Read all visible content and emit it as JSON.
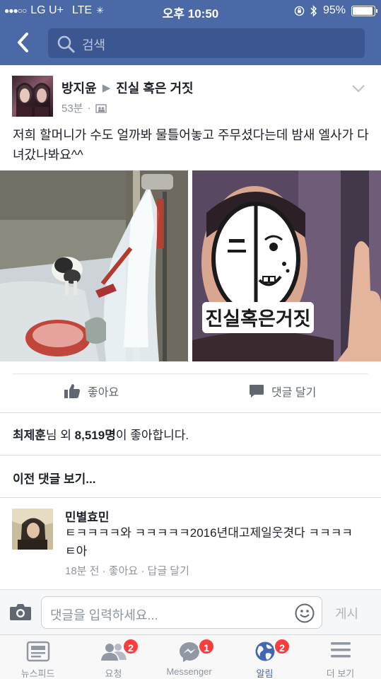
{
  "status_bar": {
    "carrier": "LG U+",
    "network": "LTE",
    "time": "오후 10:50",
    "battery_percent": "95%",
    "battery_level": 0.95
  },
  "nav": {
    "search_placeholder": "검색"
  },
  "post": {
    "author": "방지윤",
    "group": "진실 혹은 거짓",
    "time": "53분",
    "meta_sep": "·",
    "text": "저희 할머니가 수도 얼까봐 물틀어놓고 주무셨다는데 밤새 엘사가 다녀갔나봐요^^",
    "right_image_logo_text": "진실혹은거짓",
    "like_label": "좋아요",
    "comment_label": "댓글 달기"
  },
  "likes": {
    "name": "최제훈",
    "mid": "님 외 ",
    "count": "8,519명",
    "end": "이 좋아합니다."
  },
  "previous_comments": "이전 댓글 보기...",
  "comment": {
    "author": "민별효민",
    "text": "ㅌㅋㅋㅋㅋ와 ㅋㅋㅋㅋㅋ2016년대고제일웃겻다 ㅋㅋㅋㅋㅌ아",
    "meta": "18분 전 · 좋아요 · 답글 달기"
  },
  "composer": {
    "placeholder": "댓글을 입력하세요...",
    "post_label": "게시"
  },
  "tabs": [
    {
      "label": "뉴스피드",
      "icon": "news-feed-icon",
      "badge": ""
    },
    {
      "label": "요청",
      "icon": "friend-requests-icon",
      "badge": "2"
    },
    {
      "label": "Messenger",
      "icon": "messenger-icon",
      "badge": "1"
    },
    {
      "label": "알림",
      "icon": "globe-icon",
      "badge": "2"
    },
    {
      "label": "더 보기",
      "icon": "menu-icon",
      "badge": ""
    }
  ],
  "colors": {
    "brand": "#4b69a6",
    "active_tab": "#4267b2",
    "badge": "#fa3e3e"
  }
}
